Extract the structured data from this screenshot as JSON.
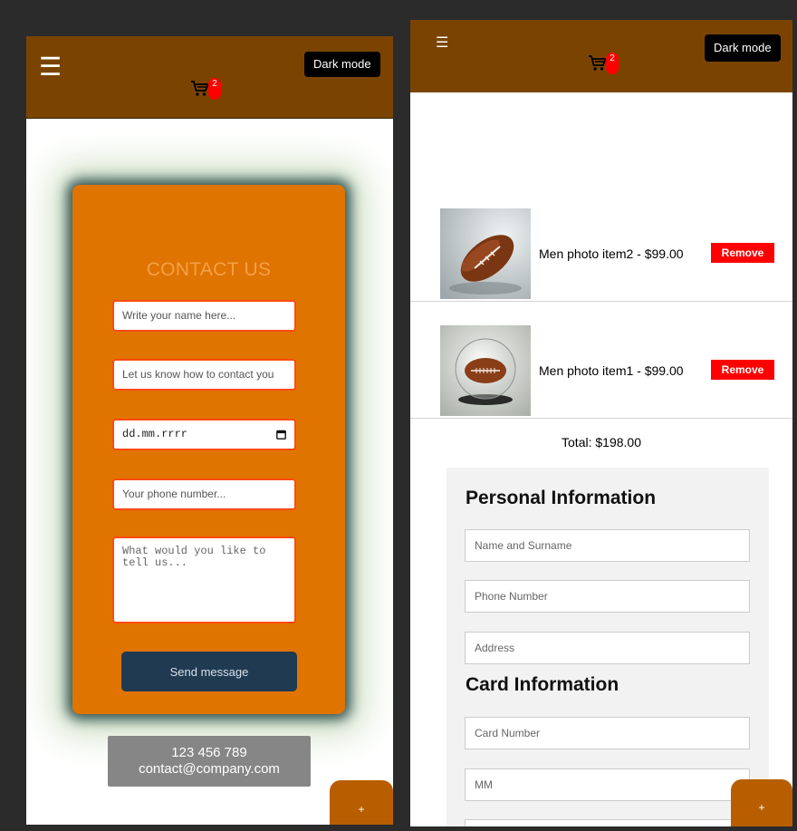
{
  "header": {
    "menu_glyph": "☰",
    "dark_mode_label": "Dark mode",
    "cart_count": "2"
  },
  "contact": {
    "title": "CONTACT US",
    "name_placeholder": "Write your name here...",
    "contact_placeholder": "Let us know how to contact you",
    "date_placeholder": "dd.mm.rrrr",
    "phone_placeholder": "Your phone number...",
    "message_placeholder": "What would you like to\ntell us...",
    "send_label": "Send message",
    "footer_phone": "123 456 789",
    "footer_email": "contact@company.com"
  },
  "fab_label": "+",
  "cart": {
    "items": [
      {
        "name": "Men photo item2 - $99.00",
        "remove_label": "Remove"
      },
      {
        "name": "Men photo item1 - $99.00",
        "remove_label": "Remove"
      }
    ],
    "total": "Total: $198.00"
  },
  "personal_info": {
    "heading": "Personal Information",
    "name_placeholder": "Name and Surname",
    "phone_placeholder": "Phone Number",
    "address_placeholder": "Address"
  },
  "card_info": {
    "heading": "Card Information",
    "card_number_placeholder": "Card Number",
    "mm_placeholder": "MM"
  },
  "colors": {
    "header_brown": "#7a4400",
    "card_orange": "#e07400",
    "send_button": "#203a52",
    "remove_red": "#ff0000",
    "badge_red": "#ff0000"
  }
}
